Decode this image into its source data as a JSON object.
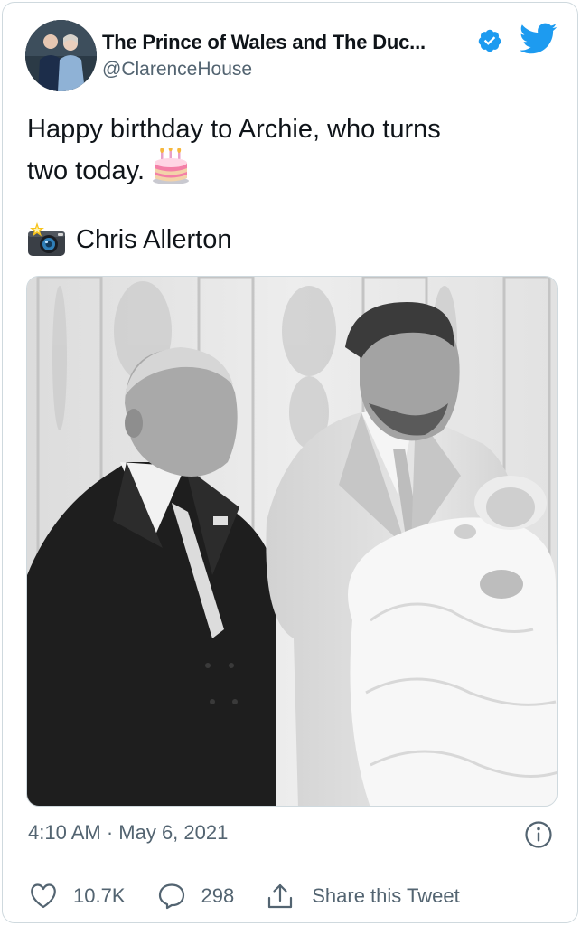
{
  "tweet": {
    "author": {
      "display_name": "The Prince of Wales and The Duc...",
      "handle": "@ClarenceHouse",
      "verified": true
    },
    "text_line1": "Happy birthday to Archie, who turns",
    "text_line2": "two today.",
    "text_emoji": "birthday-cake",
    "credit_icon": "camera-with-flash",
    "credit_name": "Chris Allerton",
    "image_description_icon": "photo",
    "timestamp": "4:10 AM · May 6, 2021",
    "actions": {
      "likes": "10.7K",
      "replies": "298",
      "share_label": "Share this Tweet"
    }
  },
  "colors": {
    "twitter_blue": "#1d9bf0",
    "text_primary": "#0f1419",
    "text_secondary": "#536471",
    "border": "#cfd9de"
  }
}
